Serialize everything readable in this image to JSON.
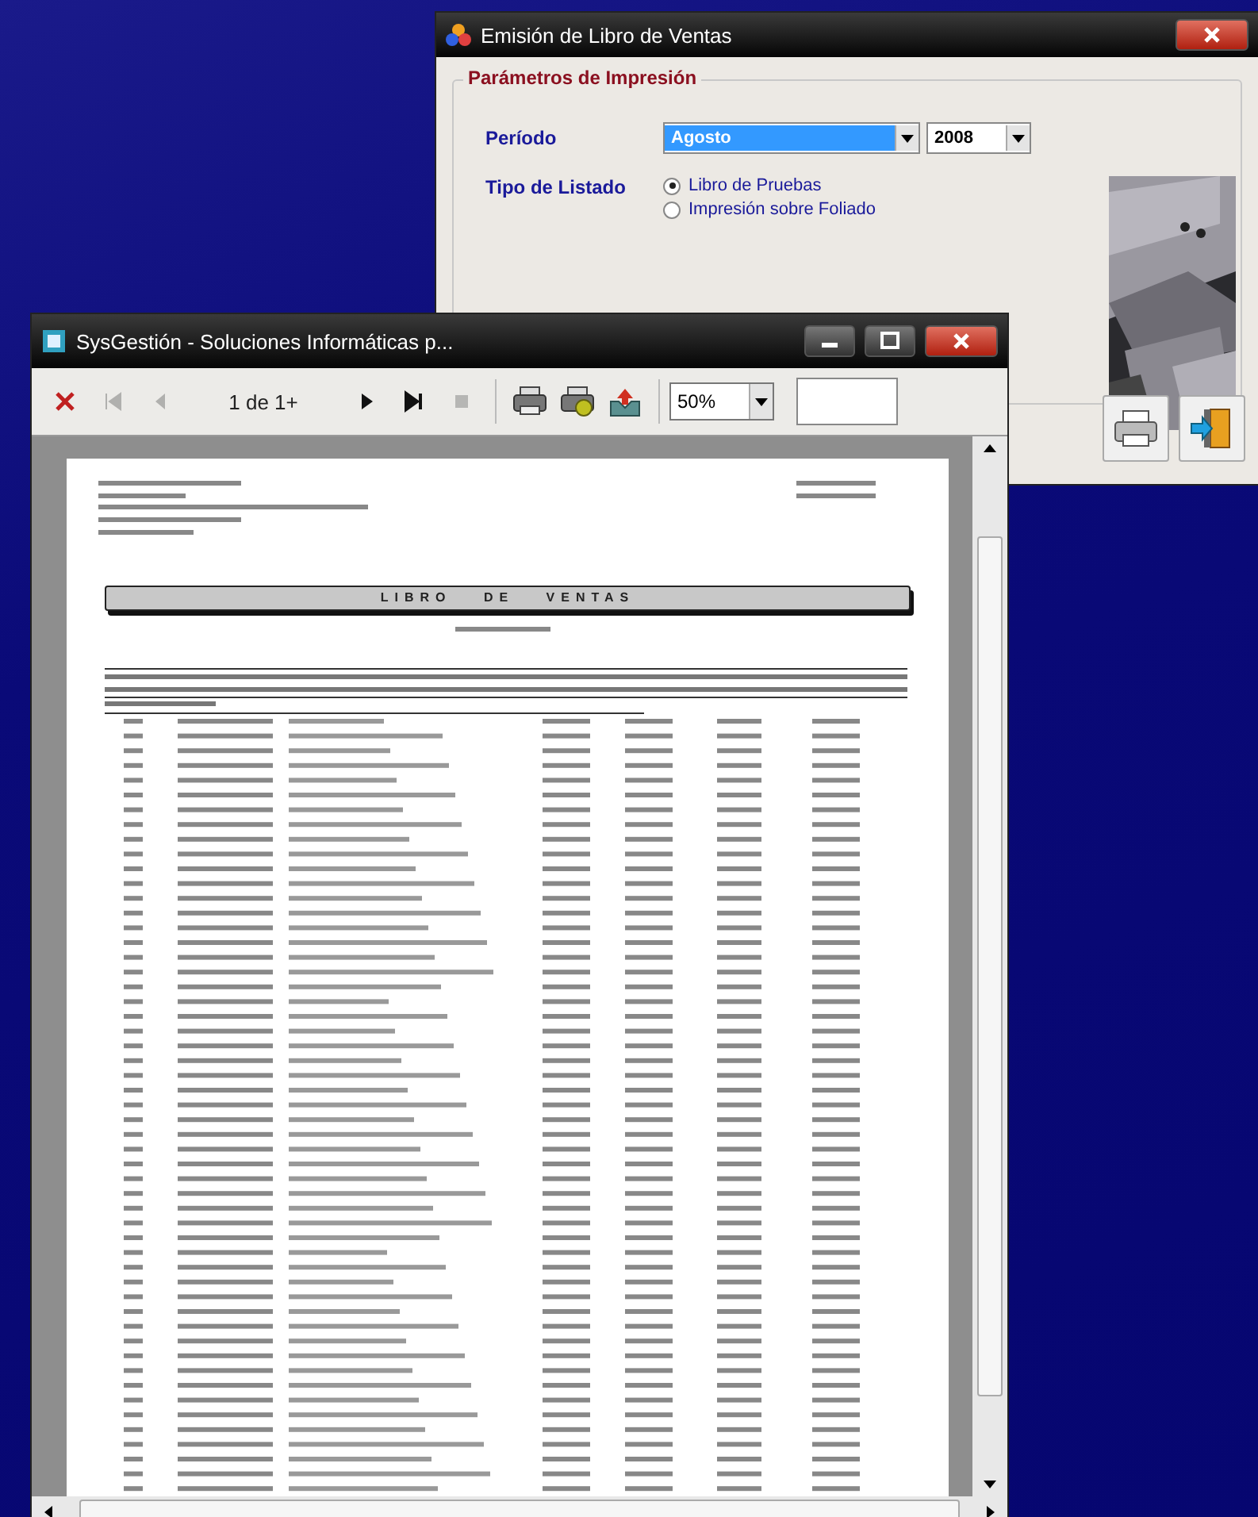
{
  "dialog": {
    "title": "Emisión de Libro de Ventas",
    "group_title": "Parámetros de Impresión",
    "period_label": "Período",
    "month": {
      "value": "Agosto",
      "focused": true
    },
    "year": {
      "value": "2008"
    },
    "list_type_label": "Tipo de Listado",
    "list_types": [
      {
        "label": "Libro de Pruebas",
        "selected": true
      },
      {
        "label": "Impresión sobre Foliado",
        "selected": false
      }
    ]
  },
  "preview": {
    "title": "SysGestión - Soluciones Informáticas p...",
    "nav_buttons": [
      {
        "kind": "first",
        "disabled": true
      },
      {
        "kind": "previous",
        "disabled": true
      },
      {
        "kind": "page"
      },
      {
        "kind": "next",
        "disabled": false
      },
      {
        "kind": "last",
        "disabled": false
      },
      {
        "kind": "stop",
        "disabled": true
      }
    ],
    "page_indicator": "1 de 1+",
    "zoom": "50%",
    "report": {
      "banner": "LIBRO DE VENTAS"
    }
  }
}
